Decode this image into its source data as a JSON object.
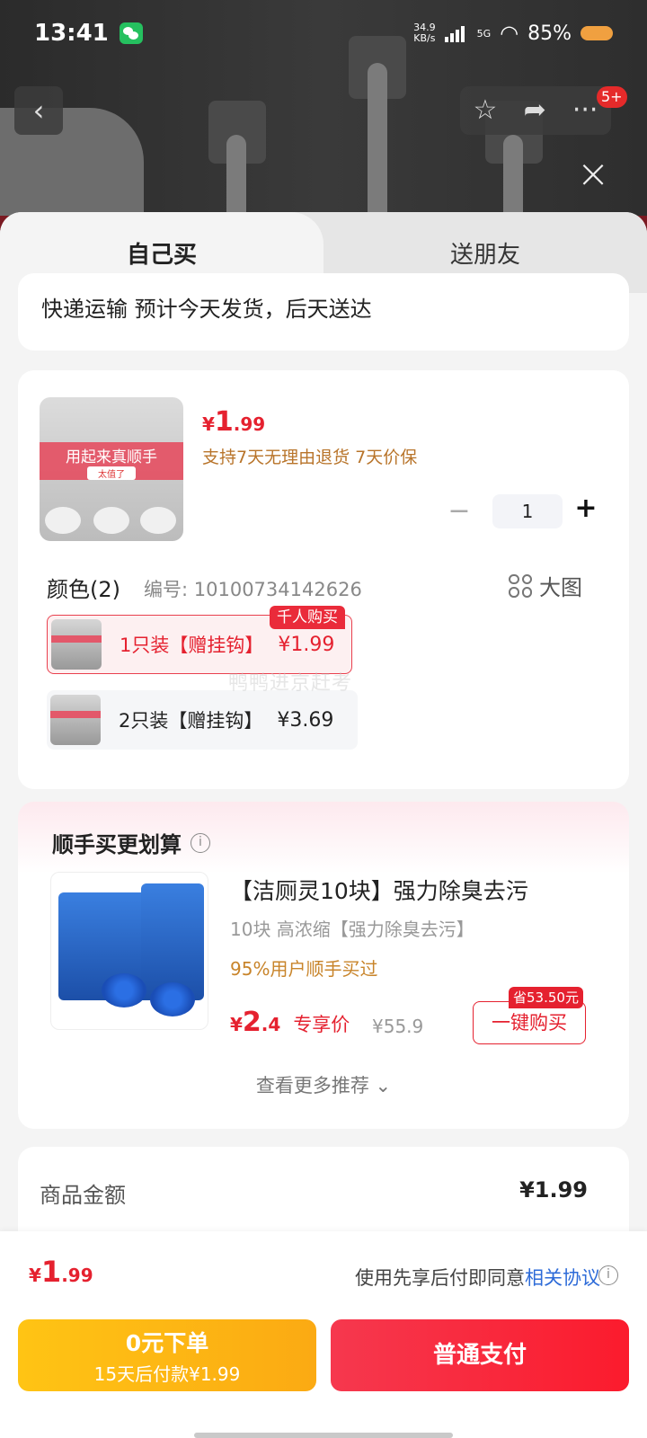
{
  "status_bar": {
    "time": "13:41",
    "net_speed_value": "34.9",
    "net_speed_unit": "KB/s",
    "network": "5G",
    "battery": "85%"
  },
  "nav": {
    "badge": "5+"
  },
  "tabs": [
    {
      "label": "自己买",
      "active": true
    },
    {
      "label": "送朋友",
      "active": false
    }
  ],
  "delivery": {
    "text": "快递运输 预计今天发货，后天送达"
  },
  "product": {
    "thumb_banner": "用起来真顺手",
    "thumb_tag": "太值了",
    "price_currency": "¥",
    "price_int": "1",
    "price_dec": ".99",
    "guarantee": "支持7天无理由退货 7天价保",
    "qty_minus": "−",
    "quantity": "1",
    "qty_plus": "+"
  },
  "sku_section": {
    "label": "颜色(2)",
    "sku_number": "编号: 10100734142626",
    "big_image": "大图",
    "hot_tag": "千人购买",
    "options": [
      {
        "label": "1只装【赠挂钩】",
        "price": "¥1.99",
        "selected": true
      },
      {
        "label": "2只装【赠挂钩】",
        "price": "¥3.69",
        "selected": false
      }
    ],
    "watermark": "鸭鸭进京赶考"
  },
  "upsell": {
    "title": "顺手买更划算",
    "info_icon": "i",
    "name": "【洁厕灵10块】强力除臭去污",
    "desc": "10块 高浓缩【强力除臭去污】",
    "bought": "95%用户顺手买过",
    "price_currency": "¥",
    "price_int": "2",
    "price_dec": ".4",
    "price_note": "专享价",
    "original_price": "¥55.9",
    "save_tag": "省53.50元",
    "buy_label": "一键购买",
    "more": "查看更多推荐 ⌄"
  },
  "summary": {
    "label": "商品金额",
    "value": "¥1.99"
  },
  "bottom": {
    "price_currency": "¥",
    "price_int": "1",
    "price_dec": ".99",
    "agree_text": "使用先享后付即同意",
    "agree_link": "相关协议",
    "later_line1": "0元下单",
    "later_line2": "15天后付款¥1.99",
    "pay_label": "普通支付"
  },
  "colors": {
    "accent_red": "#e5212f",
    "pay_later_yellow": "#fbb713",
    "link_blue": "#2d6bd8",
    "guarantee_brown": "#b8742a"
  }
}
